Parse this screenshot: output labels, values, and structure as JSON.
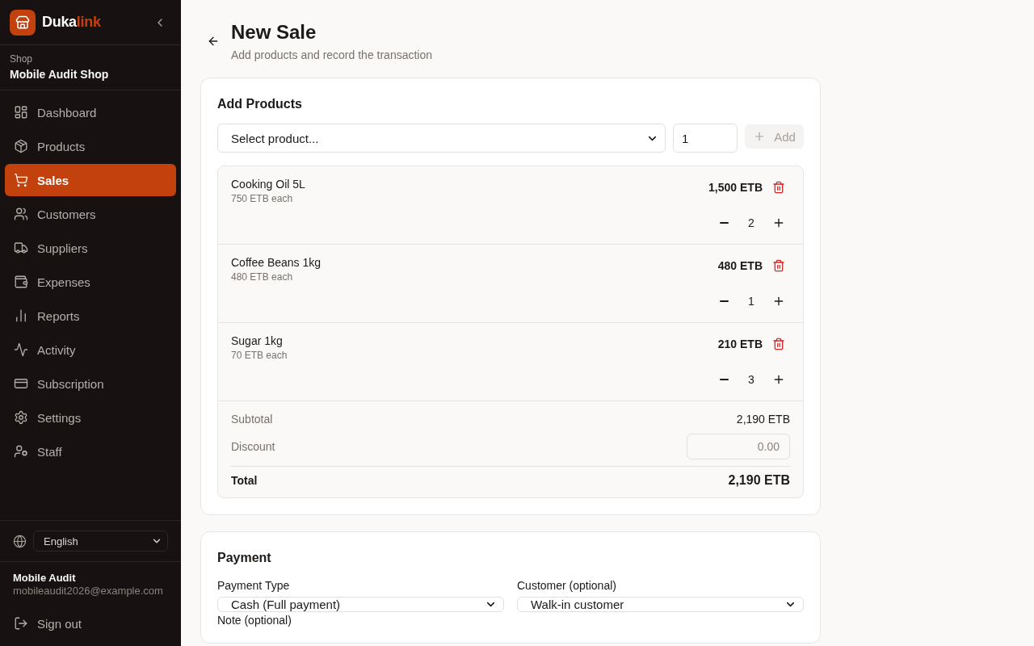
{
  "sidebar": {
    "brand": {
      "name": "Duka",
      "accent": "link"
    },
    "shop": {
      "label": "Shop",
      "name": "Mobile Audit Shop"
    },
    "nav": [
      {
        "label": "Dashboard",
        "selected": false
      },
      {
        "label": "Products",
        "selected": false
      },
      {
        "label": "Sales",
        "selected": true
      },
      {
        "label": "Customers",
        "selected": false
      },
      {
        "label": "Suppliers",
        "selected": false
      },
      {
        "label": "Expenses",
        "selected": false
      },
      {
        "label": "Reports",
        "selected": false
      },
      {
        "label": "Activity",
        "selected": false
      },
      {
        "label": "Subscription",
        "selected": false
      },
      {
        "label": "Settings",
        "selected": false
      },
      {
        "label": "Staff",
        "selected": false
      }
    ],
    "language": {
      "value": "English"
    },
    "user": {
      "name": "Mobile Audit",
      "email": "mobileaudit2026@example.com"
    },
    "sign_out": "Sign out"
  },
  "page": {
    "title": "New Sale",
    "subtitle": "Add products and record the transaction"
  },
  "add_products": {
    "title": "Add Products",
    "product_select": {
      "value": "Select product..."
    },
    "quantity": {
      "value": "1"
    },
    "add_button": {
      "label": "Add",
      "disabled": true
    },
    "items": [
      {
        "name": "Cooking Oil 5L",
        "unit_price": "750 ETB each",
        "line_total": "1,500 ETB",
        "quantity": "2"
      },
      {
        "name": "Coffee Beans 1kg",
        "unit_price": "480 ETB each",
        "line_total": "480 ETB",
        "quantity": "1"
      },
      {
        "name": "Sugar 1kg",
        "unit_price": "70 ETB each",
        "line_total": "210 ETB",
        "quantity": "3"
      }
    ],
    "subtotal": {
      "label": "Subtotal",
      "value": "2,190 ETB"
    },
    "discount": {
      "label": "Discount",
      "placeholder": "0.00"
    },
    "total": {
      "label": "Total",
      "value": "2,190 ETB"
    }
  },
  "payment": {
    "title": "Payment",
    "payment_type": {
      "label": "Payment Type",
      "value": "Cash (Full payment)"
    },
    "customer": {
      "label": "Customer (optional)",
      "value": "Walk-in customer"
    },
    "note": {
      "label": "Note (optional)"
    }
  }
}
